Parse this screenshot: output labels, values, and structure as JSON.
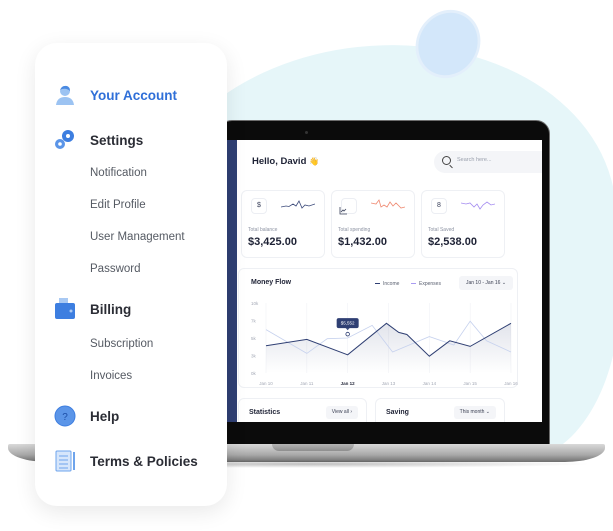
{
  "menu": {
    "items": [
      {
        "label": "Your Account",
        "icon": "user-icon",
        "active": true
      },
      {
        "label": "Settings",
        "icon": "gears-icon"
      },
      {
        "label": "Billing",
        "icon": "wallet-icon"
      },
      {
        "label": "Help",
        "icon": "help-icon"
      },
      {
        "label": "Terms & Policies",
        "icon": "document-list-icon"
      }
    ],
    "settings_sub": [
      "Notification",
      "Edit Profile",
      "User Management",
      "Password"
    ],
    "billing_sub": [
      "Subscription",
      "Invoices"
    ]
  },
  "dashboard": {
    "greeting": "Hello, David",
    "greeting_emoji": "👋",
    "search_placeholder": "Search here...",
    "cards": [
      {
        "label": "Total balance",
        "value": "$3,425.00",
        "icon": "dollar-icon",
        "icon_glyph": "$",
        "spark_color": "#3b4a7a"
      },
      {
        "label": "Total spending",
        "value": "$1,432.00",
        "icon": "chart-icon",
        "icon_glyph": "⌞",
        "spark_color": "#ef8a72"
      },
      {
        "label": "Total Saved",
        "value": "$2,538.00",
        "icon": "saving-icon",
        "icon_glyph": "8",
        "spark_color": "#a48cf0"
      }
    ],
    "money_flow": {
      "title": "Money Flow",
      "legend": [
        {
          "label": "Income",
          "color": "#2f3f73"
        },
        {
          "label": "Expenses",
          "color": "#a99bf2"
        }
      ],
      "range": "Jan 10 - Jan 16",
      "tooltip": "$5,552"
    },
    "statistics": {
      "title": "Statistics",
      "button": "View all"
    },
    "saving": {
      "title": "Saving",
      "button": "This month"
    }
  },
  "chart_data": {
    "type": "line",
    "title": "Money Flow",
    "categories": [
      "Jan 10",
      "Jan 11",
      "Jan 12",
      "Jan 13",
      "Jan 14",
      "Jan 15",
      "Jan 16"
    ],
    "highlight_category": "Jan 12",
    "y_ticks": [
      "0k",
      "3k",
      "5k",
      "7k",
      "10k"
    ],
    "ylim": [
      0,
      10
    ],
    "series": [
      {
        "name": "Income",
        "color": "#2f3f73",
        "x": [
          0,
          1,
          2,
          2.95,
          3.25,
          3.45,
          4,
          4.5,
          5,
          6
        ],
        "y": [
          3.9,
          4.8,
          2.6,
          7.1,
          5.8,
          5.5,
          2.4,
          4.6,
          3.8,
          7.1
        ]
      },
      {
        "name": "Expenses",
        "color": "#c7d2ee",
        "x": [
          0,
          1,
          1.5,
          2,
          2.6,
          3.1,
          4,
          4.6,
          5,
          5.4,
          6
        ],
        "y": [
          6.2,
          2.8,
          4.9,
          5.0,
          6.8,
          3.0,
          5.2,
          4.0,
          7.4,
          4.6,
          3.0
        ]
      }
    ],
    "tooltip": {
      "category": "Jan 12",
      "label": "$5,552",
      "value": 5.552
    }
  }
}
